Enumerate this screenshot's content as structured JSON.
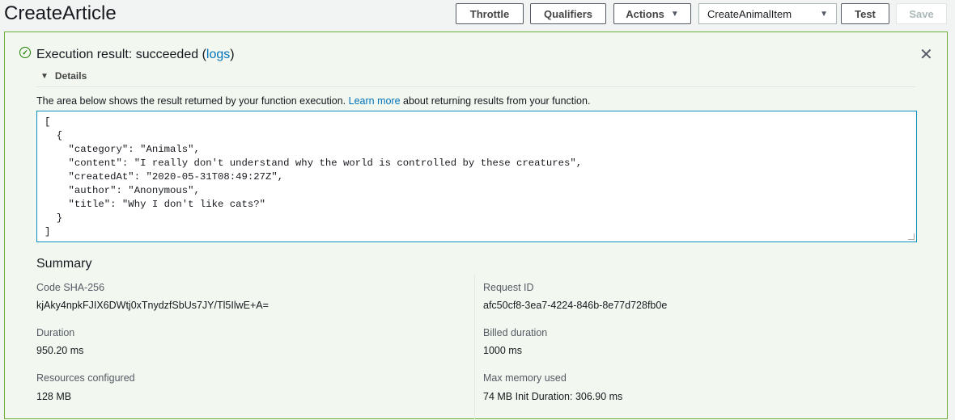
{
  "header": {
    "title": "CreateArticle",
    "throttle": "Throttle",
    "qualifiers": "Qualifiers",
    "actions": "Actions",
    "test_event": "CreateAnimalItem",
    "test": "Test",
    "save": "Save"
  },
  "result": {
    "status_prefix": "Execution result: succeeded (",
    "logs": "logs",
    "status_suffix": ")",
    "details": "Details",
    "desc_before": "The area below shows the result returned by your function execution. ",
    "learn_more": "Learn more",
    "desc_after": " about returning results from your function.",
    "output": "[\n  {\n    \"category\": \"Animals\",\n    \"content\": \"I really don't understand why the world is controlled by these creatures\",\n    \"createdAt\": \"2020-05-31T08:49:27Z\",\n    \"author\": \"Anonymous\",\n    \"title\": \"Why I don't like cats?\"\n  }\n]"
  },
  "summary": {
    "title": "Summary",
    "sha_label": "Code SHA-256",
    "sha": "kjAky4npkFJIX6DWtj0xTnydzfSbUs7JY/Tl5IlwE+A=",
    "req_label": "Request ID",
    "req": "afc50cf8-3ea7-4224-846b-8e77d728fb0e",
    "dur_label": "Duration",
    "dur": "950.20 ms",
    "billed_label": "Billed duration",
    "billed": "1000 ms",
    "res_label": "Resources configured",
    "res": "128 MB",
    "mem_label": "Max memory used",
    "mem": "74 MB Init Duration: 306.90 ms"
  }
}
